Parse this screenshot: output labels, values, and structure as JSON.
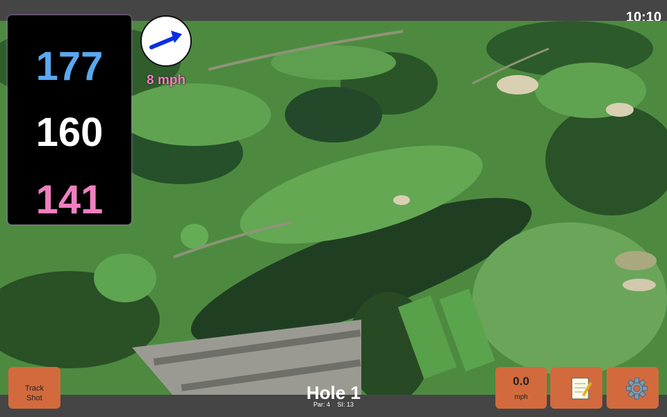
{
  "status": {
    "time": "10:10"
  },
  "distances": {
    "back": "177",
    "middle": "160",
    "front": "141"
  },
  "wind": {
    "speed_label": "8 mph",
    "direction_icon": "arrow-icon"
  },
  "hole": {
    "title": "Hole 1",
    "par": "Par: 4",
    "stroke_index": "SI: 13"
  },
  "buttons": {
    "track_shot": [
      "Track",
      "Shot"
    ],
    "speed_value": "0.0",
    "speed_unit": "mph",
    "notes_icon": "notepad-icon",
    "settings_icon": "gear-icon"
  },
  "colors": {
    "back": "#5aa8f0",
    "middle": "#ffffff",
    "front": "#f07fbf",
    "button": "#d26a3d"
  }
}
